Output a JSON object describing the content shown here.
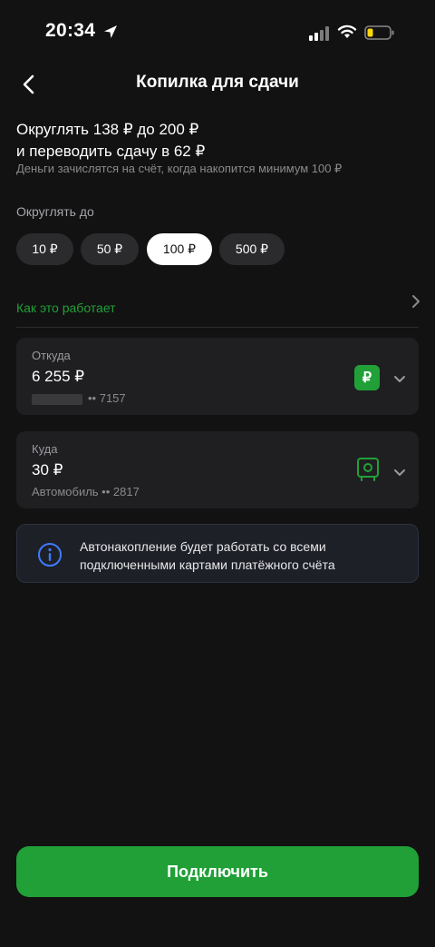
{
  "status_bar": {
    "time": "20:34"
  },
  "nav": {
    "title": "Копилка для сдачи"
  },
  "summary": {
    "line1": "Округлять 138 ₽ до 200 ₽",
    "line2": "и переводить сдачу в 62 ₽",
    "note": "Деньги зачислятся на счёт, когда накопится минимум 100 ₽"
  },
  "rounding": {
    "label": "Округлять до",
    "options": [
      "10 ₽",
      "50 ₽",
      "100 ₽",
      "500 ₽"
    ],
    "selected": "100 ₽"
  },
  "how_it_works": "Как это работает",
  "from_card": {
    "label": "Откуда",
    "amount": "6 255 ₽",
    "account": "•• 7157",
    "badge": "₽"
  },
  "to_card": {
    "label": "Куда",
    "amount": "30 ₽",
    "account": "Автомобиль •• 2817"
  },
  "info": {
    "text": "Автонакопление будет работать со всеми подключенными картами платёжного счёта"
  },
  "cta": {
    "label": "Подключить"
  },
  "colors": {
    "accent": "#21a038",
    "background": "#121212",
    "card": "#1f1f21",
    "info_icon": "#3d7bff"
  }
}
